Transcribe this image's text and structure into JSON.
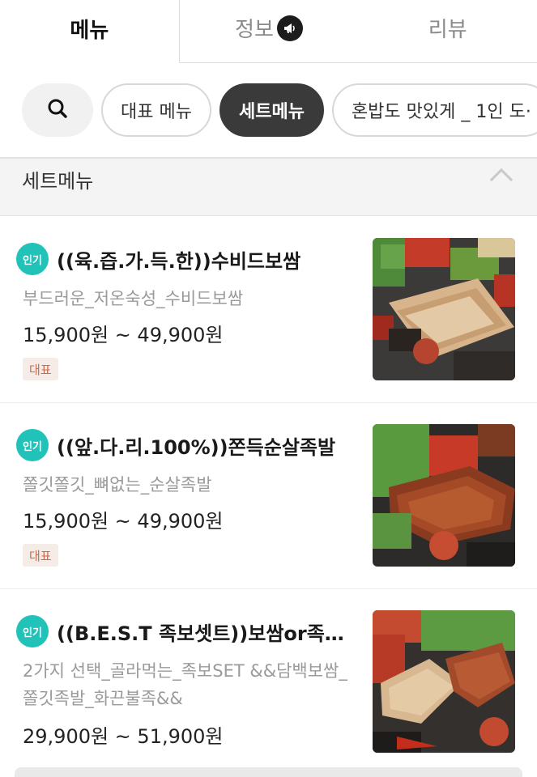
{
  "tabs": [
    {
      "label": "메뉴"
    },
    {
      "label": "정보"
    },
    {
      "label": "리뷰"
    }
  ],
  "icons": {
    "search": "search-icon",
    "megaphone": "megaphone-icon",
    "chevron": "chevron-up-icon"
  },
  "chips": [
    {
      "label": "대표 메뉴"
    },
    {
      "label": "세트메뉴"
    },
    {
      "label": "혼밥도 맛있게 _ 1인 도·"
    }
  ],
  "section": {
    "title": "세트메뉴"
  },
  "items": [
    {
      "badge": "인기",
      "name": "((육.즙.가.득.한))수비드보쌈",
      "desc": "부드러운_저온숙성_수비드보쌈",
      "price": "15,900원 ~ 49,900원",
      "tag": "대표"
    },
    {
      "badge": "인기",
      "name": "((앞.다.리.100%))쫀득순살족발",
      "desc": "쫄깃쫄깃_뼈없는_순살족발",
      "price": "15,900원 ~ 49,900원",
      "tag": "대표"
    },
    {
      "badge": "인기",
      "name": "((B.E.S.T 족보셋트))보쌈or족…",
      "desc": "2가지 선택_골라먹는_족보SET &&담백보쌈_쫄깃족발_화끈불족&&",
      "price": "29,900원 ~ 51,900원"
    }
  ],
  "colors": {
    "badge": "#21c2b8",
    "chip_selected": "#3a3a3a",
    "tag_bg": "#f5ece8",
    "tag_text": "#c96a48"
  }
}
